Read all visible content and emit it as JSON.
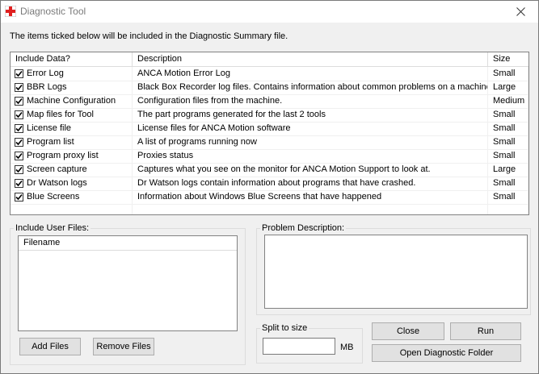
{
  "window": {
    "title": "Diagnostic Tool"
  },
  "intro_text": "The items ticked below will be included in the Diagnostic Summary file.",
  "table": {
    "columns": [
      "Include Data?",
      "Description",
      "Size"
    ],
    "rows": [
      {
        "name": "Error Log",
        "description": "ANCA Motion Error Log",
        "size": "Small",
        "checked": true
      },
      {
        "name": "BBR Logs",
        "description": "Black Box Recorder log files. Contains information about common problems on a machine.",
        "size": "Large",
        "checked": true
      },
      {
        "name": "Machine Configuration",
        "description": "Configuration files from the machine.",
        "size": "Medium",
        "checked": true
      },
      {
        "name": "Map files for Tool",
        "description": "The part programs generated for the last 2 tools",
        "size": "Small",
        "checked": true
      },
      {
        "name": "License file",
        "description": "License files for ANCA Motion software",
        "size": "Small",
        "checked": true
      },
      {
        "name": "Program list",
        "description": "A list of programs running now",
        "size": "Small",
        "checked": true
      },
      {
        "name": "Program proxy list",
        "description": "Proxies status",
        "size": "Small",
        "checked": true
      },
      {
        "name": "Screen capture",
        "description": "Captures what you see on the monitor for ANCA Motion Support to look at.",
        "size": "Large",
        "checked": true
      },
      {
        "name": "Dr Watson logs",
        "description": "Dr Watson logs contain information about programs that have crashed.",
        "size": "Small",
        "checked": true
      },
      {
        "name": "Blue Screens",
        "description": "Information about Windows Blue Screens that have happened",
        "size": "Small",
        "checked": true
      }
    ]
  },
  "user_files": {
    "group_label": "Include User Files:",
    "column": "Filename",
    "add_label": "Add Files",
    "remove_label": "Remove Files"
  },
  "problem": {
    "group_label": "Problem Description:",
    "value": ""
  },
  "split": {
    "group_label": "Split to size",
    "value": "",
    "unit": "MB"
  },
  "buttons": {
    "close": "Close",
    "run": "Run",
    "open_folder": "Open Diagnostic Folder"
  },
  "icons": {
    "app": "red-cross-icon",
    "close": "close-icon",
    "check": "checkmark-icon"
  },
  "colors": {
    "app_icon": "#e02020",
    "title_text": "#7a7a7a"
  }
}
